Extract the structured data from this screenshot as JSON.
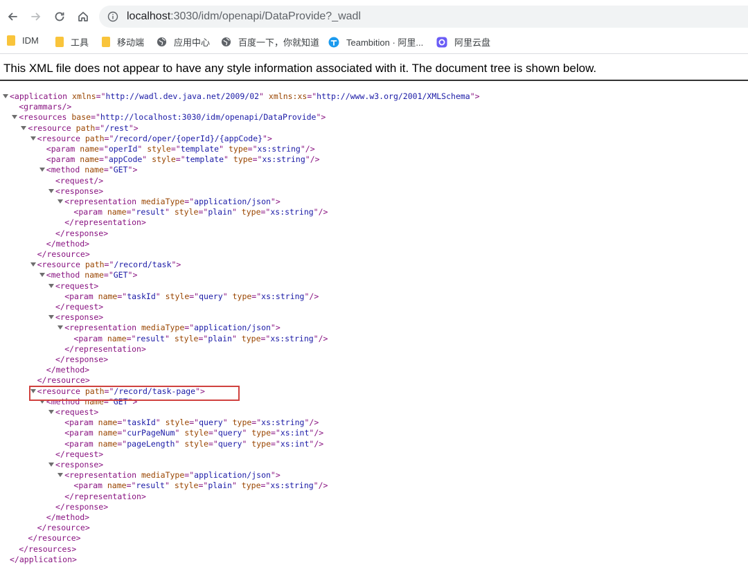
{
  "browser": {
    "url_host": "localhost",
    "url_rest": ":3030/idm/openapi/DataProvide?_wadl"
  },
  "bookmarks": [
    {
      "label": "IDM",
      "icon": "folder-icon"
    },
    {
      "label": "工具",
      "icon": "folder-icon"
    },
    {
      "label": "移动端",
      "icon": "folder-icon"
    },
    {
      "label": "应用中心",
      "icon": "globe-icon"
    },
    {
      "label": "百度一下，你就知道",
      "icon": "globe-icon"
    },
    {
      "label": "Teambition · 阿里...",
      "icon": "teambition-icon"
    },
    {
      "label": "阿里云盘",
      "icon": "aliyun-drive-icon"
    }
  ],
  "notice": "This XML file does not appear to have any style information associated with it. The document tree is shown below.",
  "xml_lines": [
    {
      "indent": 0,
      "tri": true,
      "parts": [
        [
          "t",
          "<application "
        ],
        [
          "a",
          "xmlns"
        ],
        [
          "t",
          "=\""
        ],
        [
          "v",
          "http://wadl.dev.java.net/2009/02"
        ],
        [
          "t",
          "\" "
        ],
        [
          "a",
          "xmlns:xs"
        ],
        [
          "t",
          "=\""
        ],
        [
          "v",
          "http://www.w3.org/2001/XMLSchema"
        ],
        [
          "t",
          "\">"
        ]
      ]
    },
    {
      "indent": 1,
      "tri": false,
      "parts": [
        [
          "t",
          "<grammars/>"
        ]
      ]
    },
    {
      "indent": 1,
      "tri": true,
      "parts": [
        [
          "t",
          "<resources "
        ],
        [
          "a",
          "base"
        ],
        [
          "t",
          "=\""
        ],
        [
          "v",
          "http://localhost:3030/idm/openapi/DataProvide"
        ],
        [
          "t",
          "\">"
        ]
      ]
    },
    {
      "indent": 2,
      "tri": true,
      "parts": [
        [
          "t",
          "<resource "
        ],
        [
          "a",
          "path"
        ],
        [
          "t",
          "=\""
        ],
        [
          "v",
          "/rest"
        ],
        [
          "t",
          "\">"
        ]
      ]
    },
    {
      "indent": 3,
      "tri": true,
      "parts": [
        [
          "t",
          "<resource "
        ],
        [
          "a",
          "path"
        ],
        [
          "t",
          "=\""
        ],
        [
          "v",
          "/record/oper/{operId}/{appCode}"
        ],
        [
          "t",
          "\">"
        ]
      ]
    },
    {
      "indent": 4,
      "tri": false,
      "parts": [
        [
          "t",
          "<param "
        ],
        [
          "a",
          "name"
        ],
        [
          "t",
          "=\""
        ],
        [
          "v",
          "operId"
        ],
        [
          "t",
          "\" "
        ],
        [
          "a",
          "style"
        ],
        [
          "t",
          "=\""
        ],
        [
          "v",
          "template"
        ],
        [
          "t",
          "\" "
        ],
        [
          "a",
          "type"
        ],
        [
          "t",
          "=\""
        ],
        [
          "v",
          "xs:string"
        ],
        [
          "t",
          "\"/>"
        ]
      ]
    },
    {
      "indent": 4,
      "tri": false,
      "parts": [
        [
          "t",
          "<param "
        ],
        [
          "a",
          "name"
        ],
        [
          "t",
          "=\""
        ],
        [
          "v",
          "appCode"
        ],
        [
          "t",
          "\" "
        ],
        [
          "a",
          "style"
        ],
        [
          "t",
          "=\""
        ],
        [
          "v",
          "template"
        ],
        [
          "t",
          "\" "
        ],
        [
          "a",
          "type"
        ],
        [
          "t",
          "=\""
        ],
        [
          "v",
          "xs:string"
        ],
        [
          "t",
          "\"/>"
        ]
      ]
    },
    {
      "indent": 4,
      "tri": true,
      "parts": [
        [
          "t",
          "<method "
        ],
        [
          "a",
          "name"
        ],
        [
          "t",
          "=\""
        ],
        [
          "v",
          "GET"
        ],
        [
          "t",
          "\">"
        ]
      ]
    },
    {
      "indent": 5,
      "tri": false,
      "parts": [
        [
          "t",
          "<request/>"
        ]
      ]
    },
    {
      "indent": 5,
      "tri": true,
      "parts": [
        [
          "t",
          "<response>"
        ]
      ]
    },
    {
      "indent": 6,
      "tri": true,
      "parts": [
        [
          "t",
          "<representation "
        ],
        [
          "a",
          "mediaType"
        ],
        [
          "t",
          "=\""
        ],
        [
          "v",
          "application/json"
        ],
        [
          "t",
          "\">"
        ]
      ]
    },
    {
      "indent": 7,
      "tri": false,
      "parts": [
        [
          "t",
          "<param "
        ],
        [
          "a",
          "name"
        ],
        [
          "t",
          "=\""
        ],
        [
          "v",
          "result"
        ],
        [
          "t",
          "\" "
        ],
        [
          "a",
          "style"
        ],
        [
          "t",
          "=\""
        ],
        [
          "v",
          "plain"
        ],
        [
          "t",
          "\" "
        ],
        [
          "a",
          "type"
        ],
        [
          "t",
          "=\""
        ],
        [
          "v",
          "xs:string"
        ],
        [
          "t",
          "\"/>"
        ]
      ]
    },
    {
      "indent": 6,
      "tri": false,
      "parts": [
        [
          "t",
          "</representation>"
        ]
      ]
    },
    {
      "indent": 5,
      "tri": false,
      "parts": [
        [
          "t",
          "</response>"
        ]
      ]
    },
    {
      "indent": 4,
      "tri": false,
      "parts": [
        [
          "t",
          "</method>"
        ]
      ]
    },
    {
      "indent": 3,
      "tri": false,
      "parts": [
        [
          "t",
          "</resource>"
        ]
      ]
    },
    {
      "indent": 3,
      "tri": true,
      "parts": [
        [
          "t",
          "<resource "
        ],
        [
          "a",
          "path"
        ],
        [
          "t",
          "=\""
        ],
        [
          "v",
          "/record/task"
        ],
        [
          "t",
          "\">"
        ]
      ]
    },
    {
      "indent": 4,
      "tri": true,
      "parts": [
        [
          "t",
          "<method "
        ],
        [
          "a",
          "name"
        ],
        [
          "t",
          "=\""
        ],
        [
          "v",
          "GET"
        ],
        [
          "t",
          "\">"
        ]
      ]
    },
    {
      "indent": 5,
      "tri": true,
      "parts": [
        [
          "t",
          "<request>"
        ]
      ]
    },
    {
      "indent": 6,
      "tri": false,
      "parts": [
        [
          "t",
          "<param "
        ],
        [
          "a",
          "name"
        ],
        [
          "t",
          "=\""
        ],
        [
          "v",
          "taskId"
        ],
        [
          "t",
          "\" "
        ],
        [
          "a",
          "style"
        ],
        [
          "t",
          "=\""
        ],
        [
          "v",
          "query"
        ],
        [
          "t",
          "\" "
        ],
        [
          "a",
          "type"
        ],
        [
          "t",
          "=\""
        ],
        [
          "v",
          "xs:string"
        ],
        [
          "t",
          "\"/>"
        ]
      ]
    },
    {
      "indent": 5,
      "tri": false,
      "parts": [
        [
          "t",
          "</request>"
        ]
      ]
    },
    {
      "indent": 5,
      "tri": true,
      "parts": [
        [
          "t",
          "<response>"
        ]
      ]
    },
    {
      "indent": 6,
      "tri": true,
      "parts": [
        [
          "t",
          "<representation "
        ],
        [
          "a",
          "mediaType"
        ],
        [
          "t",
          "=\""
        ],
        [
          "v",
          "application/json"
        ],
        [
          "t",
          "\">"
        ]
      ]
    },
    {
      "indent": 7,
      "tri": false,
      "parts": [
        [
          "t",
          "<param "
        ],
        [
          "a",
          "name"
        ],
        [
          "t",
          "=\""
        ],
        [
          "v",
          "result"
        ],
        [
          "t",
          "\" "
        ],
        [
          "a",
          "style"
        ],
        [
          "t",
          "=\""
        ],
        [
          "v",
          "plain"
        ],
        [
          "t",
          "\" "
        ],
        [
          "a",
          "type"
        ],
        [
          "t",
          "=\""
        ],
        [
          "v",
          "xs:string"
        ],
        [
          "t",
          "\"/>"
        ]
      ]
    },
    {
      "indent": 6,
      "tri": false,
      "parts": [
        [
          "t",
          "</representation>"
        ]
      ]
    },
    {
      "indent": 5,
      "tri": false,
      "parts": [
        [
          "t",
          "</response>"
        ]
      ]
    },
    {
      "indent": 4,
      "tri": false,
      "parts": [
        [
          "t",
          "</method>"
        ]
      ]
    },
    {
      "indent": 3,
      "tri": false,
      "parts": [
        [
          "t",
          "</resource>"
        ]
      ]
    },
    {
      "indent": 3,
      "tri": true,
      "parts": [
        [
          "t",
          "<resource "
        ],
        [
          "a",
          "path"
        ],
        [
          "t",
          "=\""
        ],
        [
          "v",
          "/record/task-page"
        ],
        [
          "t",
          "\">"
        ]
      ]
    },
    {
      "indent": 4,
      "tri": true,
      "parts": [
        [
          "t",
          "<method "
        ],
        [
          "a",
          "name"
        ],
        [
          "t",
          "=\""
        ],
        [
          "v",
          "GET"
        ],
        [
          "t",
          "\">"
        ]
      ]
    },
    {
      "indent": 5,
      "tri": true,
      "parts": [
        [
          "t",
          "<request>"
        ]
      ]
    },
    {
      "indent": 6,
      "tri": false,
      "parts": [
        [
          "t",
          "<param "
        ],
        [
          "a",
          "name"
        ],
        [
          "t",
          "=\""
        ],
        [
          "v",
          "taskId"
        ],
        [
          "t",
          "\" "
        ],
        [
          "a",
          "style"
        ],
        [
          "t",
          "=\""
        ],
        [
          "v",
          "query"
        ],
        [
          "t",
          "\" "
        ],
        [
          "a",
          "type"
        ],
        [
          "t",
          "=\""
        ],
        [
          "v",
          "xs:string"
        ],
        [
          "t",
          "\"/>"
        ]
      ]
    },
    {
      "indent": 6,
      "tri": false,
      "parts": [
        [
          "t",
          "<param "
        ],
        [
          "a",
          "name"
        ],
        [
          "t",
          "=\""
        ],
        [
          "v",
          "curPageNum"
        ],
        [
          "t",
          "\" "
        ],
        [
          "a",
          "style"
        ],
        [
          "t",
          "=\""
        ],
        [
          "v",
          "query"
        ],
        [
          "t",
          "\" "
        ],
        [
          "a",
          "type"
        ],
        [
          "t",
          "=\""
        ],
        [
          "v",
          "xs:int"
        ],
        [
          "t",
          "\"/>"
        ]
      ]
    },
    {
      "indent": 6,
      "tri": false,
      "parts": [
        [
          "t",
          "<param "
        ],
        [
          "a",
          "name"
        ],
        [
          "t",
          "=\""
        ],
        [
          "v",
          "pageLength"
        ],
        [
          "t",
          "\" "
        ],
        [
          "a",
          "style"
        ],
        [
          "t",
          "=\""
        ],
        [
          "v",
          "query"
        ],
        [
          "t",
          "\" "
        ],
        [
          "a",
          "type"
        ],
        [
          "t",
          "=\""
        ],
        [
          "v",
          "xs:int"
        ],
        [
          "t",
          "\"/>"
        ]
      ]
    },
    {
      "indent": 5,
      "tri": false,
      "parts": [
        [
          "t",
          "</request>"
        ]
      ]
    },
    {
      "indent": 5,
      "tri": true,
      "parts": [
        [
          "t",
          "<response>"
        ]
      ]
    },
    {
      "indent": 6,
      "tri": true,
      "parts": [
        [
          "t",
          "<representation "
        ],
        [
          "a",
          "mediaType"
        ],
        [
          "t",
          "=\""
        ],
        [
          "v",
          "application/json"
        ],
        [
          "t",
          "\">"
        ]
      ]
    },
    {
      "indent": 7,
      "tri": false,
      "parts": [
        [
          "t",
          "<param "
        ],
        [
          "a",
          "name"
        ],
        [
          "t",
          "=\""
        ],
        [
          "v",
          "result"
        ],
        [
          "t",
          "\" "
        ],
        [
          "a",
          "style"
        ],
        [
          "t",
          "=\""
        ],
        [
          "v",
          "plain"
        ],
        [
          "t",
          "\" "
        ],
        [
          "a",
          "type"
        ],
        [
          "t",
          "=\""
        ],
        [
          "v",
          "xs:string"
        ],
        [
          "t",
          "\"/>"
        ]
      ]
    },
    {
      "indent": 6,
      "tri": false,
      "parts": [
        [
          "t",
          "</representation>"
        ]
      ]
    },
    {
      "indent": 5,
      "tri": false,
      "parts": [
        [
          "t",
          "</response>"
        ]
      ]
    },
    {
      "indent": 4,
      "tri": false,
      "parts": [
        [
          "t",
          "</method>"
        ]
      ]
    },
    {
      "indent": 3,
      "tri": false,
      "parts": [
        [
          "t",
          "</resource>"
        ]
      ]
    },
    {
      "indent": 2,
      "tri": false,
      "parts": [
        [
          "t",
          "</resource>"
        ]
      ]
    },
    {
      "indent": 1,
      "tri": false,
      "parts": [
        [
          "t",
          "</resources>"
        ]
      ]
    },
    {
      "indent": 0,
      "tri": false,
      "parts": [
        [
          "t",
          "</application>"
        ]
      ]
    }
  ],
  "colors": {
    "tag": "#881280",
    "attr": "#994500",
    "value": "#1a1aa6",
    "highlight_box": "#d0413e"
  }
}
